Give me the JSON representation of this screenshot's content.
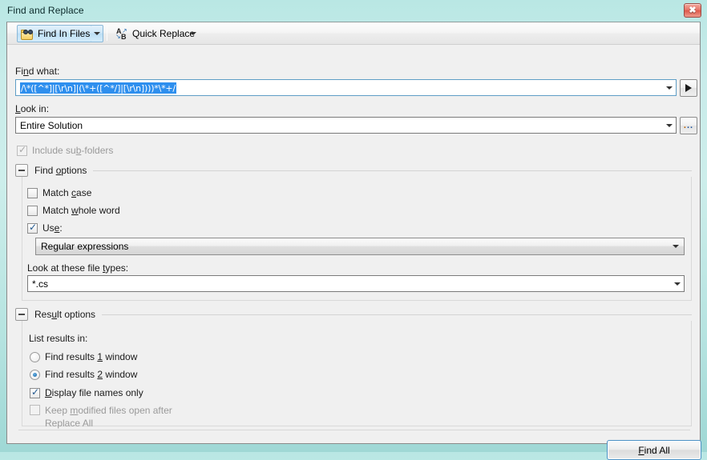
{
  "window": {
    "title": "Find and Replace",
    "close_label": "✖"
  },
  "toolbar": {
    "find_in_files_label": "Find In Files",
    "find_in_files_icon": "folder-binoculars-icon",
    "quick_replace_label": "Quick Replace",
    "quick_replace_icon": "replace-a-b-icon",
    "dropdown_icon": "chevron-down-icon"
  },
  "find_what": {
    "label": "Find what:",
    "label_prefix": "Fi",
    "label_accel": "n",
    "label_suffix": "d what:",
    "value": "/\\*([^*]|[\\r\\n]|(\\*+([^*/]|[\\r\\n])))*\\*+/",
    "expand_button_icon": "play-triangle-icon"
  },
  "look_in": {
    "label": "Look in:",
    "label_prefix": "",
    "label_accel": "L",
    "label_suffix": "ook in:",
    "value": "Entire Solution",
    "browse_button_label": "...",
    "browse_button_icon": "ellipsis-icon",
    "include_subfolders": {
      "label": "Include sub-folders",
      "label_prefix": "Include su",
      "label_accel": "b",
      "label_suffix": "-folders",
      "checked": true,
      "enabled": false,
      "check_glyph": "✓"
    }
  },
  "find_options": {
    "title": "Find options",
    "title_prefix": "Find ",
    "title_accel": "o",
    "title_suffix": "ptions",
    "expanded": true,
    "expander_glyph": "−",
    "match_case": {
      "label": "Match case",
      "label_prefix": "Match ",
      "label_accel": "c",
      "label_suffix": "ase",
      "checked": false,
      "enabled": true,
      "check_glyph": "✓"
    },
    "match_whole_word": {
      "label": "Match whole word",
      "label_prefix": "Match ",
      "label_accel": "w",
      "label_suffix": "hole word",
      "checked": false,
      "enabled": true,
      "check_glyph": "✓"
    },
    "use": {
      "label": "Use:",
      "label_prefix": "Us",
      "label_accel": "e",
      "label_suffix": ":",
      "checked": true,
      "enabled": true,
      "check_glyph": "✓"
    },
    "use_value": "Regular expressions",
    "file_types": {
      "label": "Look at these file types:",
      "label_prefix": "Look at these file ",
      "label_accel": "t",
      "label_suffix": "ypes:",
      "value": "*.cs"
    }
  },
  "result_options": {
    "title": "Result options",
    "title_prefix": "Res",
    "title_accel": "u",
    "title_suffix": "lt options",
    "expanded": true,
    "expander_glyph": "−",
    "list_results_label": "List results in:",
    "radios": [
      {
        "label": "Find results 1 window",
        "label_prefix": "Find results ",
        "label_accel": "1",
        "label_suffix": " window",
        "selected": false
      },
      {
        "label": "Find results 2 window",
        "label_prefix": "Find results ",
        "label_accel": "2",
        "label_suffix": " window",
        "selected": true
      }
    ],
    "display_file_names_only": {
      "label": "Display file names only",
      "label_prefix": "",
      "label_accel": "D",
      "label_suffix": "isplay file names only",
      "checked": true,
      "enabled": true,
      "check_glyph": "✓"
    },
    "keep_modified": {
      "label_line1": "Keep modified files open after",
      "label_line1_prefix": "Keep ",
      "label_line1_accel": "m",
      "label_line1_suffix": "odified files open after",
      "label_line2": "Replace All",
      "checked": false,
      "enabled": false,
      "check_glyph": "✓"
    }
  },
  "footer": {
    "find_all_label": "Find All",
    "find_all_prefix": "",
    "find_all_accel": "F",
    "find_all_suffix": "ind All"
  },
  "colors": {
    "titlebar": "#c5ebe8",
    "dialog_bg": "#f0f0f0",
    "selection_blue": "#2e8fee",
    "accent_button_border": "#4a90c4",
    "close_red": "#dd5a4b",
    "disabled_text": "#9a9a9a"
  }
}
